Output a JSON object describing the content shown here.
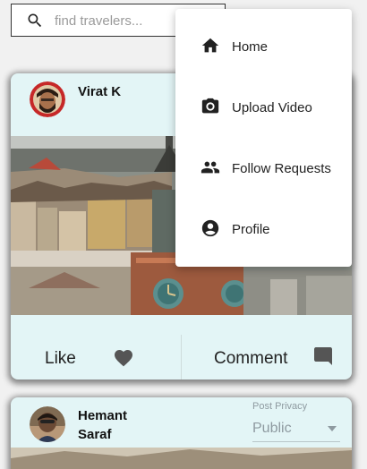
{
  "search": {
    "placeholder": "find travelers...",
    "icon": "search-icon"
  },
  "menu": {
    "items": [
      {
        "label": "Home",
        "icon": "home-icon"
      },
      {
        "label": "Upload Video",
        "icon": "camera-icon"
      },
      {
        "label": "Follow Requests",
        "icon": "people-icon"
      },
      {
        "label": "Profile",
        "icon": "account-circle-icon"
      }
    ]
  },
  "posts": [
    {
      "author": "Virat K",
      "actions": {
        "like_label": "Like",
        "comment_label": "Comment"
      }
    },
    {
      "author": "Hemant Saraf",
      "privacy": {
        "label": "Post Privacy",
        "value": "Public"
      }
    }
  ],
  "colors": {
    "card_bg": "#e3f5f6",
    "menu_bg": "#ffffff",
    "page_bg": "#f1f1f1",
    "icon": "#212121"
  }
}
